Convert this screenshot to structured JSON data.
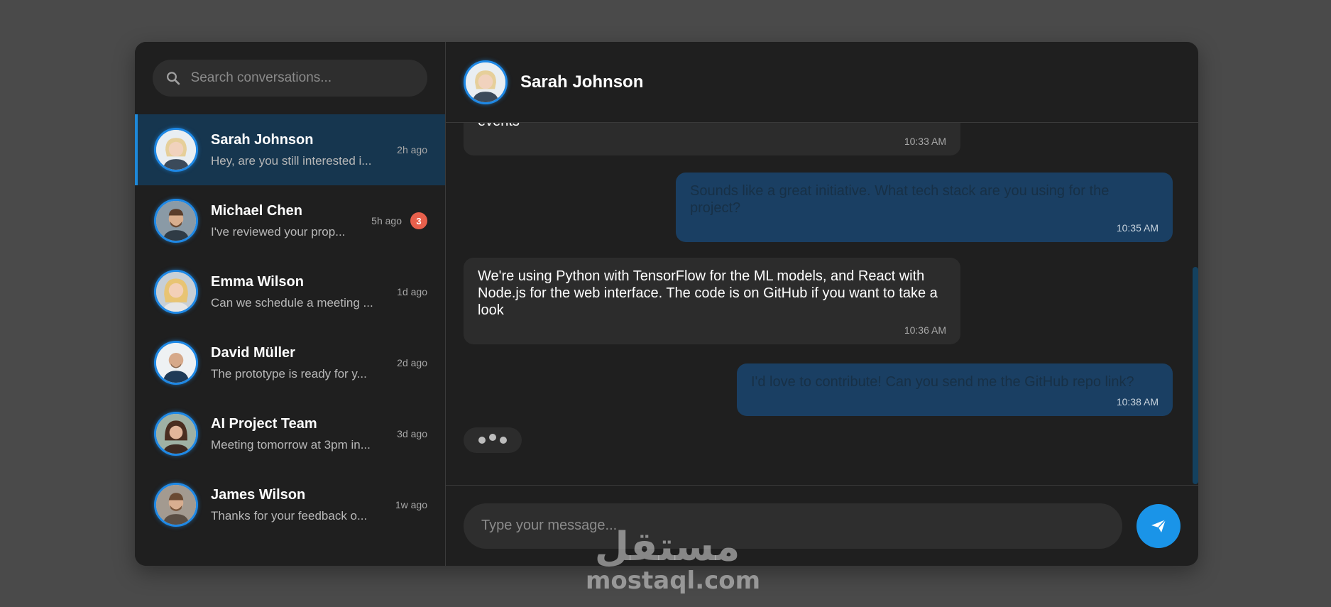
{
  "search": {
    "placeholder": "Search conversations..."
  },
  "conversations": [
    {
      "name": "Sarah Johnson",
      "preview": "Hey, are you still interested i...",
      "time": "2h ago",
      "unread": "",
      "active": true
    },
    {
      "name": "Michael Chen",
      "preview": "I've reviewed your prop...",
      "time": "5h ago",
      "unread": "3",
      "active": false
    },
    {
      "name": "Emma Wilson",
      "preview": "Can we schedule a meeting ...",
      "time": "1d ago",
      "unread": "",
      "active": false
    },
    {
      "name": "David Müller",
      "preview": "The prototype is ready for y...",
      "time": "2d ago",
      "unread": "",
      "active": false
    },
    {
      "name": "AI Project Team",
      "preview": "Meeting tomorrow at 3pm in...",
      "time": "3d ago",
      "unread": "",
      "active": false
    },
    {
      "name": "James Wilson",
      "preview": "Thanks for your feedback o...",
      "time": "1w ago",
      "unread": "",
      "active": false
    }
  ],
  "chat": {
    "contact_name": "Sarah Johnson",
    "messages": [
      {
        "direction": "in",
        "text": "events",
        "time": "10:33 AM"
      },
      {
        "direction": "out",
        "text": "Sounds like a great initiative. What tech stack are you using for the project?",
        "time": "10:35 AM"
      },
      {
        "direction": "in",
        "text": "We're using Python with TensorFlow for the ML models, and React with Node.js for the web interface. The code is on GitHub if you want to take a look",
        "time": "10:36 AM"
      },
      {
        "direction": "out",
        "text": "I'd love to contribute! Can you send me the GitHub repo link?",
        "time": "10:38 AM"
      }
    ]
  },
  "composer": {
    "placeholder": "Type your message..."
  },
  "watermark": {
    "arabic": "مستقل",
    "latin": "mostaql.com"
  },
  "colors": {
    "accent": "#1e88e5",
    "active_row": "#16364f",
    "badge": "#e8604c",
    "send": "#1a94e8"
  }
}
